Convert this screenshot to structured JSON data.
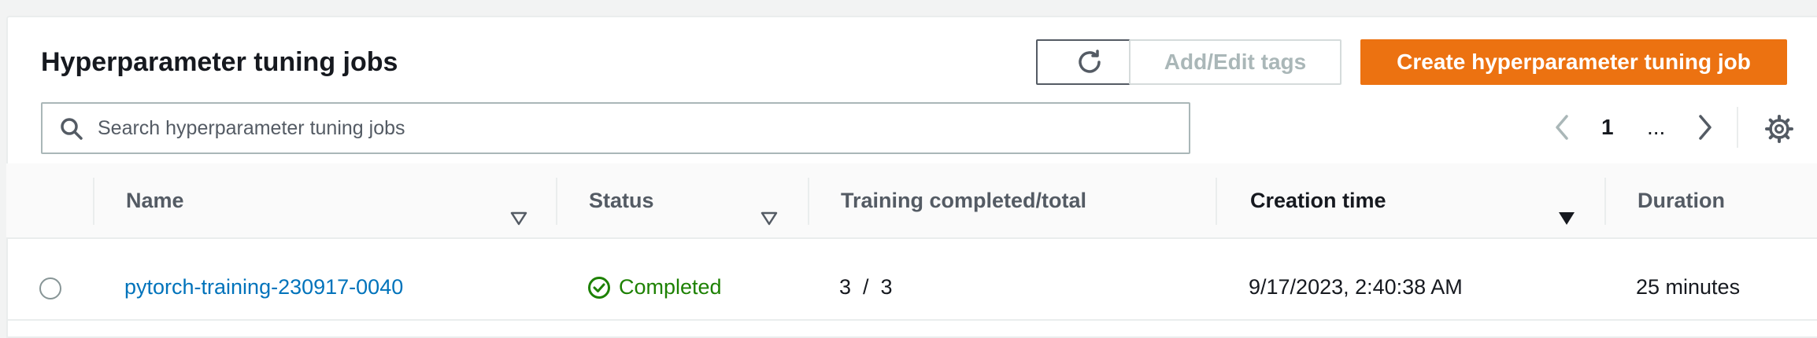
{
  "table": {
    "title": "Hyperparameter tuning jobs",
    "buttons": {
      "add_edit_tags": "Add/Edit tags",
      "create": "Create hyperparameter tuning job"
    },
    "search": {
      "placeholder": "Search hyperparameter tuning jobs",
      "value": ""
    },
    "pagination": {
      "current_page": "1",
      "ellipsis": "..."
    },
    "columns": {
      "name": "Name",
      "status": "Status",
      "training": "Training completed/total",
      "creation_time": "Creation time",
      "duration": "Duration"
    },
    "rows": [
      {
        "name": "pytorch-training-230917-0040",
        "status": "Completed",
        "training": "3  /  3",
        "creation_time": "9/17/2023, 2:40:38 AM",
        "duration": "25 minutes"
      }
    ]
  },
  "icons": {
    "refresh": "refresh-icon",
    "search": "search-icon",
    "prev": "chevron-left-icon",
    "next": "chevron-right-icon",
    "settings": "gear-icon",
    "status": "check-circle-icon"
  },
  "colors": {
    "primary_button": "#ec7211",
    "link": "#0073bb",
    "success": "#1d8102"
  }
}
